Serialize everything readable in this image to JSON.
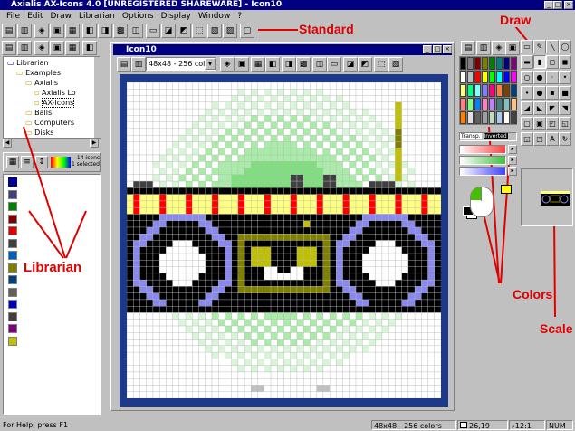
{
  "window": {
    "title": "Axialis AX-Icons 4.0 [UNREGISTERED SHAREWARE] - Icon10"
  },
  "menu": [
    "File",
    "Edit",
    "Draw",
    "Librarian",
    "Options",
    "Display",
    "Window",
    "?"
  ],
  "annotations": {
    "standard": "Standard",
    "draw": "Draw",
    "librarian": "Librarian",
    "colors": "Colors",
    "scale": "Scale"
  },
  "librarian": {
    "tree": [
      {
        "label": "Librarian",
        "level": 0
      },
      {
        "label": "Examples",
        "level": 1
      },
      {
        "label": "Axialis",
        "level": 2
      },
      {
        "label": "Axialis Lo",
        "level": 3
      },
      {
        "label": "AX-Icons",
        "level": 3,
        "selected": true
      },
      {
        "label": "Balls",
        "level": 2
      },
      {
        "label": "Computers",
        "level": 2
      },
      {
        "label": "Disks",
        "level": 2
      }
    ],
    "count_line1": "14 icons",
    "count_line2": "1 selected"
  },
  "document": {
    "title": "Icon10",
    "format": "48x48 - 256 colors"
  },
  "colors": {
    "transparent_label": "Transp.",
    "inverted_label": "Inverted",
    "palette": [
      "#000000",
      "#808080",
      "#800000",
      "#808000",
      "#008000",
      "#008080",
      "#000080",
      "#800080",
      "#ffffff",
      "#c0c0c0",
      "#ff0000",
      "#ffff00",
      "#00ff00",
      "#00ffff",
      "#0000ff",
      "#ff00ff",
      "#ffff80",
      "#00ff80",
      "#80ffff",
      "#8080ff",
      "#ff0080",
      "#ff8040",
      "#804000",
      "#004080",
      "#ff8080",
      "#80ff80",
      "#0080ff",
      "#ff80c0",
      "#c080ff",
      "#408080",
      "#80c0c0",
      "#ffc080",
      "#ff8000",
      "#e0e0e0",
      "#606060",
      "#a0a0a4",
      "#c0dcc0",
      "#a6caf0",
      "#fffbf0",
      "#404040"
    ]
  },
  "status": {
    "help": "For Help, press F1",
    "format": "48x48 - 256 colors",
    "position": "26,19",
    "zoom": "12:1",
    "num": "NUM"
  }
}
